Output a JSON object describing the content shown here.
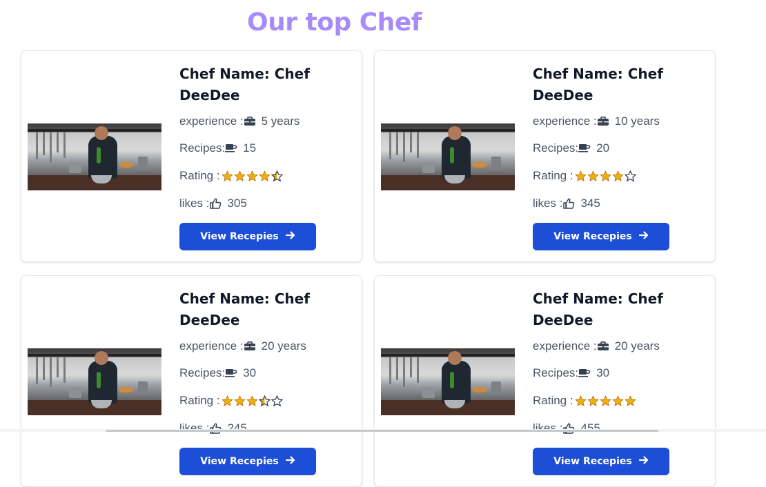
{
  "page": {
    "title": "Our top Chef",
    "accent_color": "#a78bfa",
    "button_color": "#1d4ed8",
    "star_color": "#eab308"
  },
  "chefs": [
    {
      "name_line1": "Chef Name: Chef",
      "name_line2": "DeeDee",
      "experience_label": "experience :",
      "experience_value": "5 years",
      "recipes_label": "Recipes:",
      "recipes_value": "15",
      "rating_label": "Rating :",
      "rating": 4.5,
      "likes_label": "likes :",
      "likes_value": "305",
      "button_label": "View Recepies"
    },
    {
      "name_line1": "Chef Name: Chef",
      "name_line2": "DeeDee",
      "experience_label": "experience :",
      "experience_value": "10 years",
      "recipes_label": "Recipes:",
      "recipes_value": "20",
      "rating_label": "Rating :",
      "rating": 4,
      "likes_label": "likes :",
      "likes_value": "345",
      "button_label": "View Recepies"
    },
    {
      "name_line1": "Chef Name: Chef",
      "name_line2": "DeeDee",
      "experience_label": "experience :",
      "experience_value": "20 years",
      "recipes_label": "Recipes:",
      "recipes_value": "30",
      "rating_label": "Rating :",
      "rating": 3.5,
      "likes_label": "likes :",
      "likes_value": "245",
      "button_label": "View Recepies"
    },
    {
      "name_line1": "Chef Name: Chef",
      "name_line2": "DeeDee",
      "experience_label": "experience :",
      "experience_value": "20 years",
      "recipes_label": "Recipes:",
      "recipes_value": "30",
      "rating_label": "Rating :",
      "rating": 5,
      "likes_label": "likes :",
      "likes_value": "455",
      "button_label": "View Recepies"
    }
  ],
  "icons": {
    "experience": "briefcase-icon",
    "recipes": "coffee-cup-icon",
    "likes": "thumbs-up-icon",
    "button": "arrow-right-icon"
  }
}
